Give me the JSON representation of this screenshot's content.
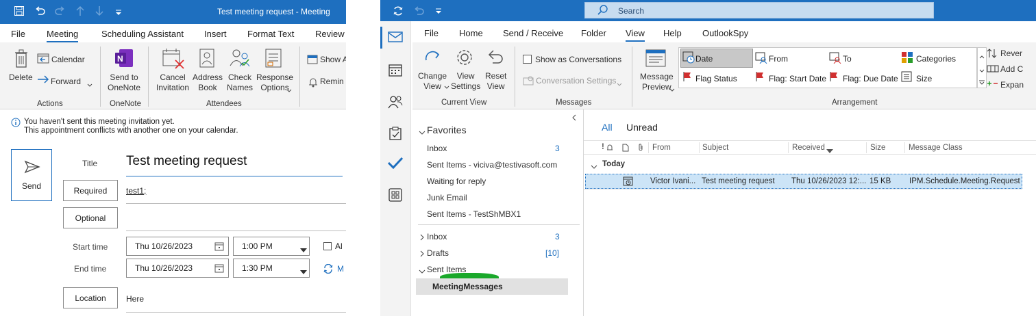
{
  "meeting_window": {
    "title": "Test meeting request  -  Meeting",
    "menu": [
      "File",
      "Meeting",
      "Scheduling Assistant",
      "Insert",
      "Format Text",
      "Review"
    ],
    "ribbon": {
      "delete": "Delete",
      "calendar": "Calendar",
      "forward": "Forward",
      "actions_group": "Actions",
      "send_to_onenote": [
        "Send to",
        "OneNote"
      ],
      "onenote_group": "OneNote",
      "cancel_invitation": [
        "Cancel",
        "Invitation"
      ],
      "address_book": [
        "Address",
        "Book"
      ],
      "check_names": [
        "Check",
        "Names"
      ],
      "response_options": [
        "Response",
        "Options"
      ],
      "attendees_group": "Attendees",
      "show_as": "Show A",
      "reminder": "Remin"
    },
    "info": [
      "You haven't sent this meeting invitation yet.",
      "This appointment conflicts with another one on your calendar."
    ],
    "send": "Send",
    "title_label": "Title",
    "title_value": "Test meeting request",
    "required": "Required",
    "required_value": "test1;",
    "optional": "Optional",
    "start_label": "Start time",
    "start_date": "Thu 10/26/2023",
    "start_time": "1:00 PM",
    "end_label": "End time",
    "end_date": "Thu 10/26/2023",
    "end_time": "1:30 PM",
    "allday": "Al",
    "make_recurring": "M",
    "location": "Location",
    "location_value": "Here"
  },
  "outlook_window": {
    "search_placeholder": "Search",
    "menu": [
      "File",
      "Home",
      "Send / Receive",
      "Folder",
      "View",
      "Help",
      "OutlookSpy"
    ],
    "ribbon": {
      "change_view": [
        "Change",
        "View"
      ],
      "view_settings": [
        "View",
        "Settings"
      ],
      "reset_view": [
        "Reset",
        "View"
      ],
      "current_view_group": "Current View",
      "show_as_conversations": "Show as Conversations",
      "conversation_settings": "Conversation Settings",
      "messages_group": "Messages",
      "message_preview": [
        "Message",
        "Preview"
      ],
      "arrangement": [
        "Date",
        "From",
        "To",
        "Categories",
        "Flag Status",
        "Flag: Start Date",
        "Flag: Due Date",
        "Size"
      ],
      "arrangement_group": "Arrangement",
      "reverse": "Rever",
      "add_columns": "Add C",
      "expand": "Expan"
    },
    "favorites": {
      "header": "Favorites",
      "items": [
        {
          "name": "Inbox",
          "count": "3"
        },
        {
          "name": "Sent Items - viciva@testivasoft.com",
          "count": ""
        },
        {
          "name": "Waiting for reply",
          "count": ""
        },
        {
          "name": "Junk Email",
          "count": ""
        },
        {
          "name": "Sent Items - TestShMBX1",
          "count": ""
        }
      ]
    },
    "folders": [
      {
        "name": "Inbox",
        "count": "3"
      },
      {
        "name": "Drafts",
        "count": "[10]"
      },
      {
        "name": "Sent Items",
        "count": ""
      }
    ],
    "subfolder": "MeetingMessages",
    "tabs": [
      "All",
      "Unread"
    ],
    "columns": [
      "From",
      "Subject",
      "Received",
      "Size",
      "Message Class"
    ],
    "group_header": "Today",
    "row": {
      "from": "Victor Ivani...",
      "subject": "Test meeting request",
      "received": "Thu 10/26/2023 12:...",
      "size": "15 KB",
      "class": "IPM.Schedule.Meeting.Request"
    }
  },
  "colors": {
    "accent": "#1e6fbf",
    "selection": "#cce4f7",
    "highlight_green": "#1aa82a"
  }
}
